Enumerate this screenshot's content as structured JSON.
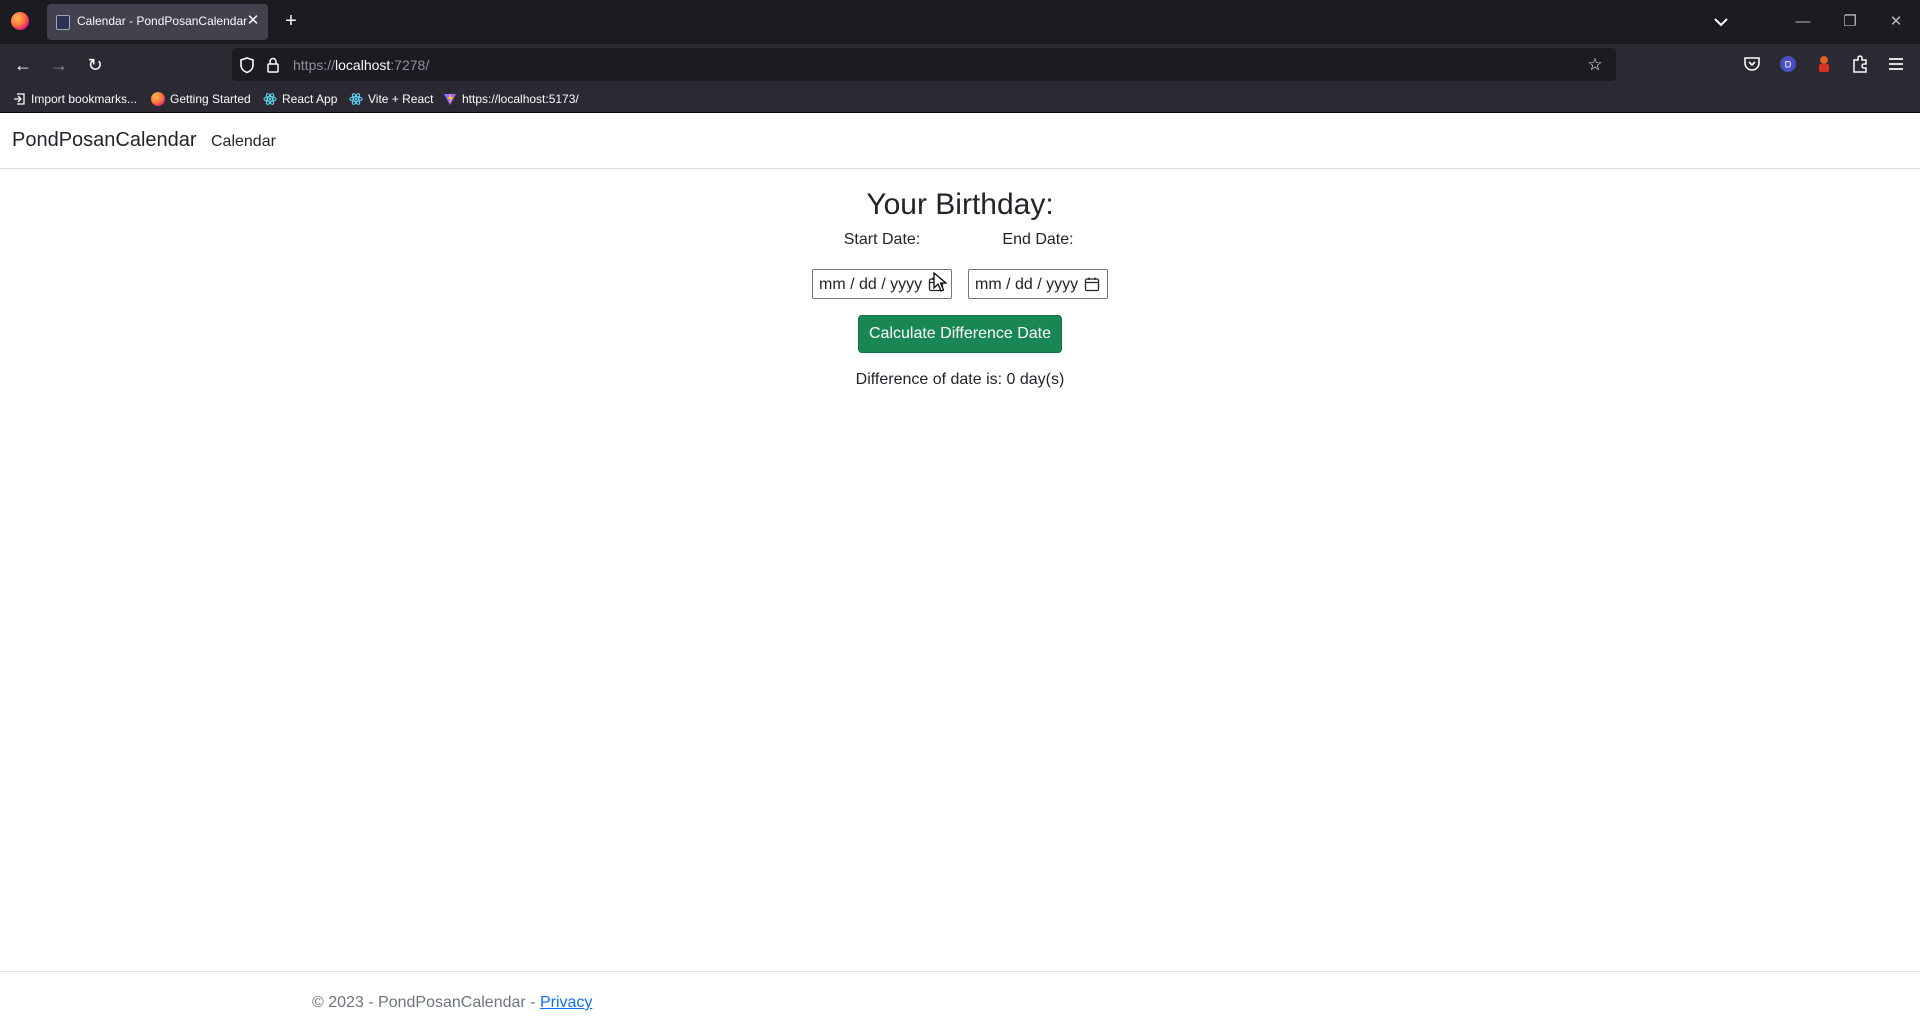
{
  "browser": {
    "tab_title": "Calendar - PondPosanCalendar",
    "url_scheme": "https://",
    "url_host": "localhost",
    "url_rest": ":7278/",
    "bookmarks": [
      {
        "label": "Import bookmarks...",
        "icon": "import-icon"
      },
      {
        "label": "Getting Started",
        "icon": "firefox-icon"
      },
      {
        "label": "React App",
        "icon": "react-icon"
      },
      {
        "label": "Vite + React",
        "icon": "react-icon"
      },
      {
        "label": "https://localhost:5173/",
        "icon": "vite-icon"
      }
    ],
    "profile_initial": "D"
  },
  "header": {
    "brand": "PondPosanCalendar",
    "nav": [
      "Calendar"
    ]
  },
  "main": {
    "title": "Your Birthday:",
    "start_label": "Start Date:",
    "end_label": "End Date:",
    "start_placeholder": "mm / dd / yyyy",
    "end_placeholder": "mm / dd / yyyy",
    "button_label": "Calculate Difference Date",
    "result_text": "Difference of date is: 0 day(s)"
  },
  "footer": {
    "text": "© 2023 - PondPosanCalendar - ",
    "link": "Privacy"
  },
  "colors": {
    "button": "#198754",
    "link": "#0d6efd",
    "chrome_dark": "#1c1b22",
    "chrome_bar": "#2b2a33"
  }
}
